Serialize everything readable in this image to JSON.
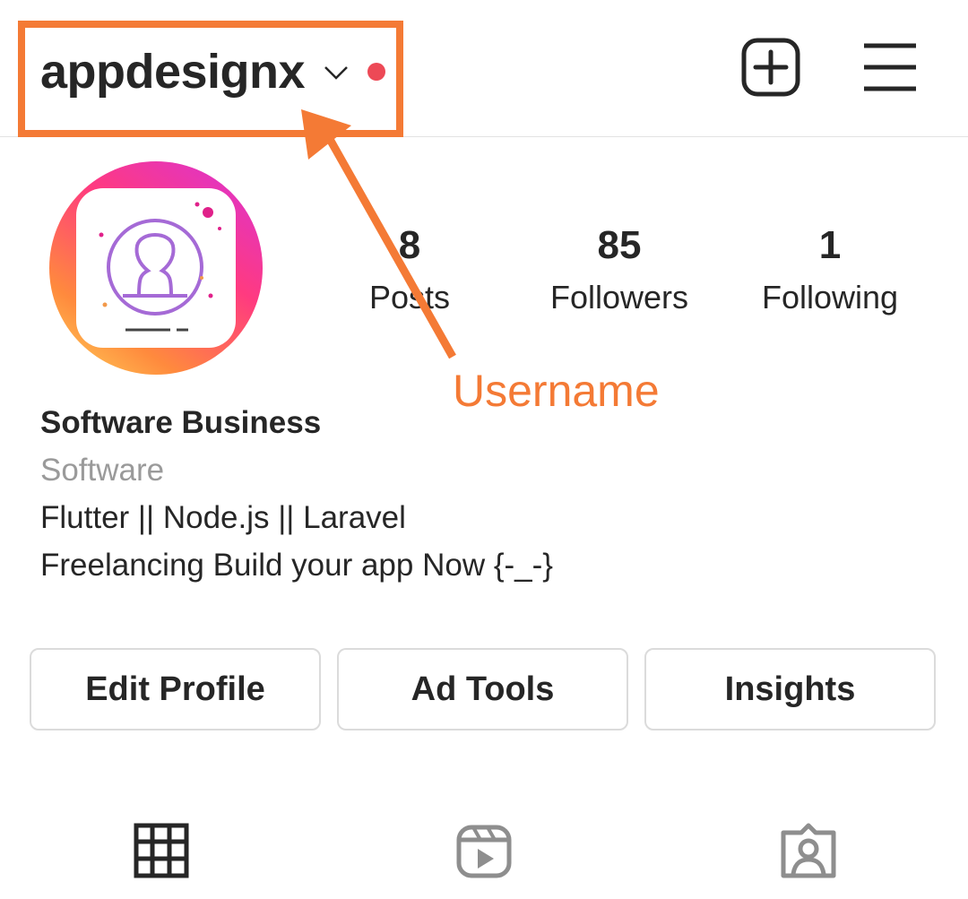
{
  "header": {
    "username": "appdesignx",
    "add_icon": "plus-square-icon",
    "menu_icon": "hamburger-menu-icon",
    "notification_dot_color": "#ed4956"
  },
  "annotation": {
    "label": "Username",
    "color": "#f47a35"
  },
  "profile": {
    "avatar_icon": "user-avatar-icon",
    "stats": [
      {
        "value": "8",
        "label": "Posts"
      },
      {
        "value": "85",
        "label": "Followers"
      },
      {
        "value": "1",
        "label": "Following"
      }
    ],
    "bio": {
      "name": "Software Business",
      "category": "Software",
      "line1": "Flutter || Node.js || Laravel",
      "line2": "Freelancing Build your app Now {-_-}"
    }
  },
  "actions": {
    "edit_profile": "Edit Profile",
    "ad_tools": "Ad Tools",
    "insights": "Insights"
  },
  "tabs": [
    {
      "name": "posts-grid",
      "icon": "grid-icon",
      "active": true
    },
    {
      "name": "reels",
      "icon": "reels-icon",
      "active": false
    },
    {
      "name": "tagged",
      "icon": "tagged-user-icon",
      "active": false
    }
  ]
}
